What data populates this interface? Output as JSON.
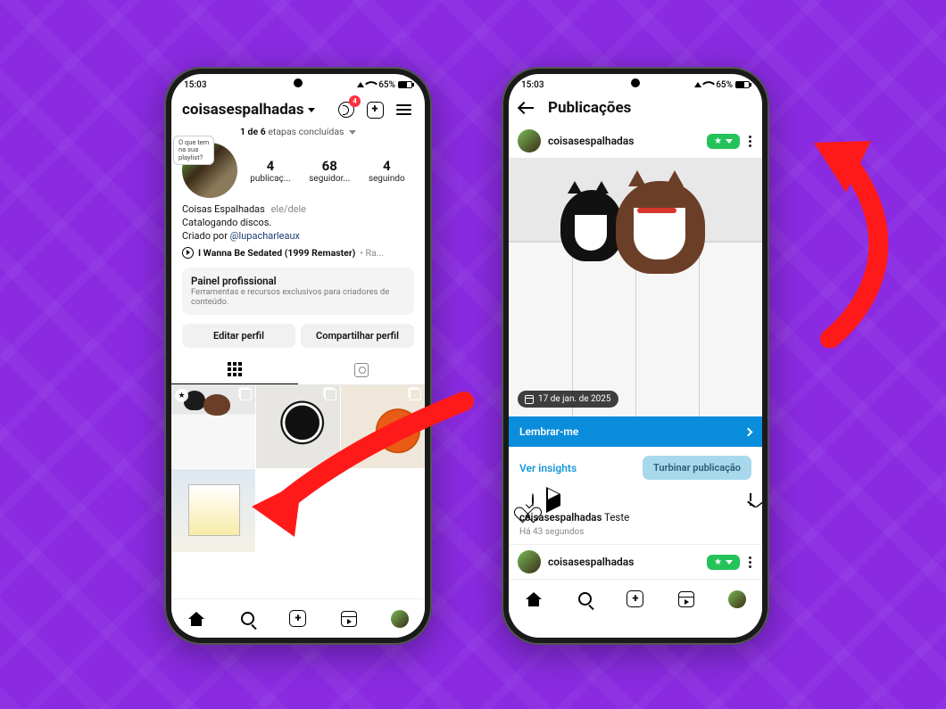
{
  "status": {
    "time": "15:03",
    "battery": "65%"
  },
  "phone1": {
    "header": {
      "username": "coisasespalhadas",
      "threads_badge": "4"
    },
    "steps": {
      "done": "1 de 6",
      "rest": "etapas concluídas"
    },
    "story_bubble": "O que tem\nna sua\nplaylist?",
    "stats": {
      "posts": {
        "n": "4",
        "l": "publicaç..."
      },
      "followers": {
        "n": "68",
        "l": "seguidor..."
      },
      "following": {
        "n": "4",
        "l": "seguindo"
      }
    },
    "bio": {
      "name": "Coisas Espalhadas",
      "pronouns": "ele/dele",
      "line2": "Catalogando discos.",
      "created": "Criado por ",
      "link": "@lupacharleaux"
    },
    "music": {
      "title": "I Wanna Be Sedated (1999 Remaster)",
      "meta": "• Ra..."
    },
    "panel": {
      "title": "Painel profissional",
      "sub": "Ferramentas e recursos exclusivos para criadores de conteúdo."
    },
    "buttons": {
      "edit": "Editar perfil",
      "share": "Compartilhar perfil"
    }
  },
  "phone2": {
    "title": "Publicações",
    "post": {
      "user": "coisasespalhadas",
      "date": "17 de jan. de 2025",
      "remind": "Lembrar-me",
      "insights": "Ver insights",
      "boost": "Turbinar publicação",
      "caption_user": "coisasespalhadas",
      "caption_text": "Teste",
      "time": "Há 43 segundos",
      "user2": "coisasespalhadas"
    }
  }
}
